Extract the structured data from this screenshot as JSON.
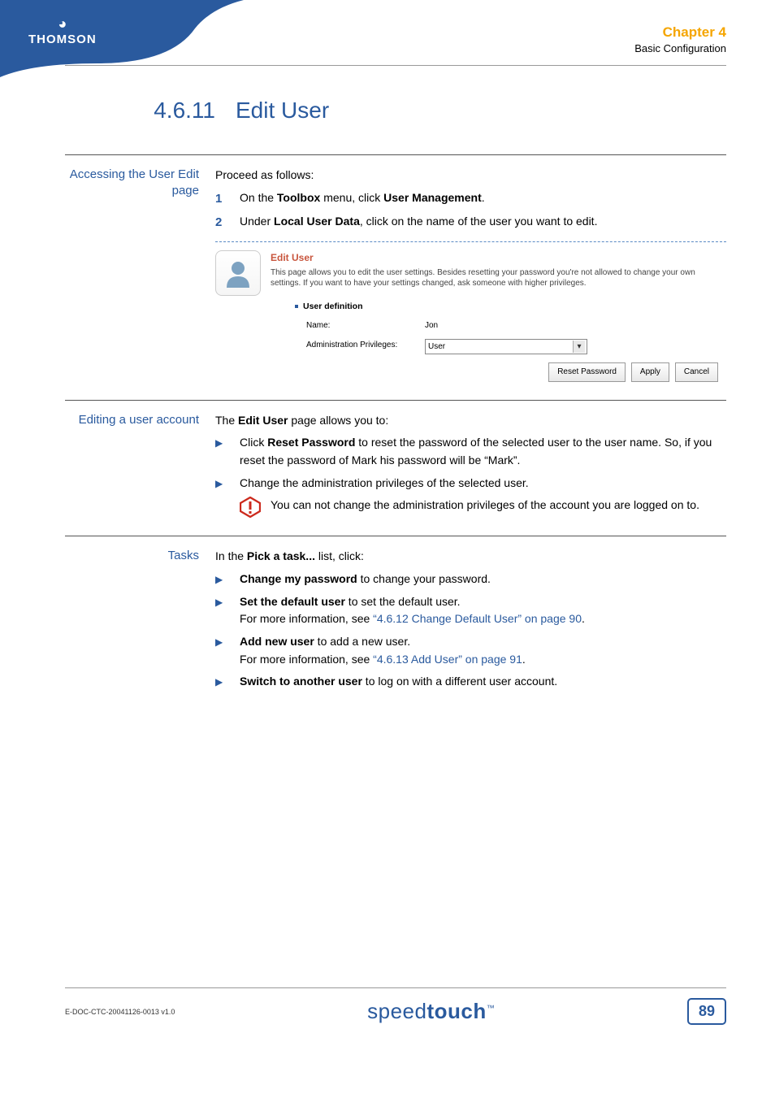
{
  "header": {
    "brand": "THOMSON",
    "chapter_label": "Chapter 4",
    "chapter_subtitle": "Basic Configuration"
  },
  "section": {
    "number": "4.6.11",
    "title": "Edit User"
  },
  "block1": {
    "label": "Accessing the User Edit page",
    "intro": "Proceed as follows:",
    "step1_pre": "On the ",
    "step1_b1": "Toolbox",
    "step1_mid": " menu, click ",
    "step1_b2": "User Management",
    "step1_post": ".",
    "step2_pre": "Under ",
    "step2_b1": "Local User Data",
    "step2_post": ", click on the name of the user you want to edit."
  },
  "panel": {
    "title": "Edit User",
    "desc": "This page allows you to edit the user settings. Besides resetting your password you're not allowed to change your own settings. If you want to have your settings changed, ask someone with higher privileges.",
    "section_title": "User definition",
    "name_label": "Name:",
    "name_value": "Jon",
    "priv_label": "Administration Privileges:",
    "priv_value": "User",
    "btn_reset": "Reset Password",
    "btn_apply": "Apply",
    "btn_cancel": "Cancel"
  },
  "block2": {
    "label": "Editing a user account",
    "intro_pre": "The ",
    "intro_b": "Edit User",
    "intro_post": " page allows you to:",
    "b1_pre": "Click ",
    "b1_b": "Reset Password",
    "b1_post": " to reset the password of the selected user to the user name. So, if you reset the password of Mark his password will be “Mark”.",
    "b2": "Change the administration privileges of the selected user.",
    "warn": "You can not change the administration privileges of the account you are logged on to."
  },
  "block3": {
    "label": "Tasks",
    "intro_pre": "In the ",
    "intro_b": "Pick a task...",
    "intro_post": " list, click:",
    "t1_b": "Change my password",
    "t1_post": " to change your password.",
    "t2_b": "Set the default user",
    "t2_post": " to set the default user.",
    "t2_line2_pre": "For more information, see ",
    "t2_link": "“4.6.12 Change Default User” on page 90",
    "t2_line2_post": ".",
    "t3_b": "Add new user",
    "t3_post": " to add a new user.",
    "t3_line2_pre": "For more information, see ",
    "t3_link": "“4.6.13 Add User” on page 91",
    "t3_line2_post": ".",
    "t4_b": "Switch to another user",
    "t4_post": " to log on with a different user account."
  },
  "footer": {
    "doc_id": "E-DOC-CTC-20041126-0013 v1.0",
    "brand_thin": "speed",
    "brand_bold": "touch",
    "page": "89"
  }
}
